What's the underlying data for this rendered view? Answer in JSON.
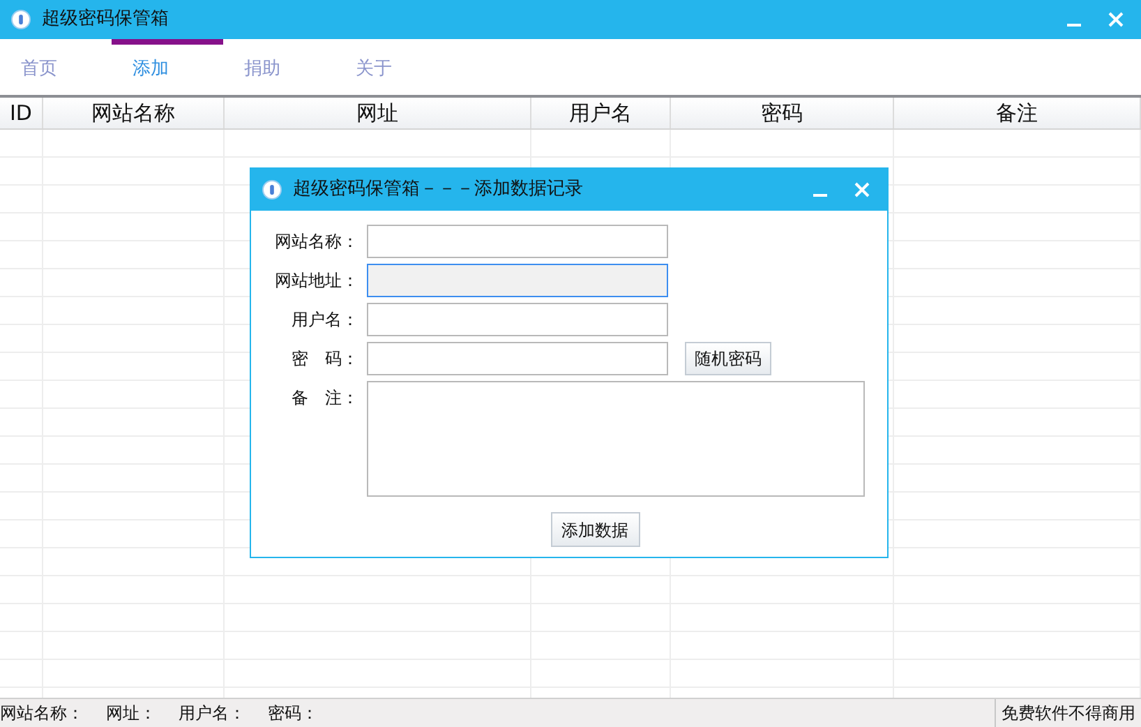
{
  "window": {
    "title": "超级密码保管箱"
  },
  "tabs": [
    {
      "label": "首页",
      "selected": false
    },
    {
      "label": "添加",
      "selected": true
    },
    {
      "label": "捐助",
      "selected": false
    },
    {
      "label": "关于",
      "selected": false
    }
  ],
  "table": {
    "columns": [
      "ID",
      "网站名称",
      "网址",
      "用户名",
      "密码",
      "备注"
    ]
  },
  "dialog": {
    "title": "超级密码保管箱－－－添加数据记录",
    "fields": [
      {
        "label": "网站名称：",
        "kind": "text",
        "focused": false
      },
      {
        "label": "网站地址：",
        "kind": "text",
        "focused": true
      },
      {
        "label": "用户名：",
        "kind": "text",
        "focused": false
      },
      {
        "label": "密　码：",
        "kind": "text",
        "focused": false,
        "action": "随机密码"
      },
      {
        "label": "备　注：",
        "kind": "textarea",
        "focused": false
      }
    ],
    "submit": "添加数据"
  },
  "status_bar": {
    "items": [
      "网站名称：",
      "网址：",
      "用户名：",
      "密码："
    ],
    "right": "免费软件不得商用"
  }
}
